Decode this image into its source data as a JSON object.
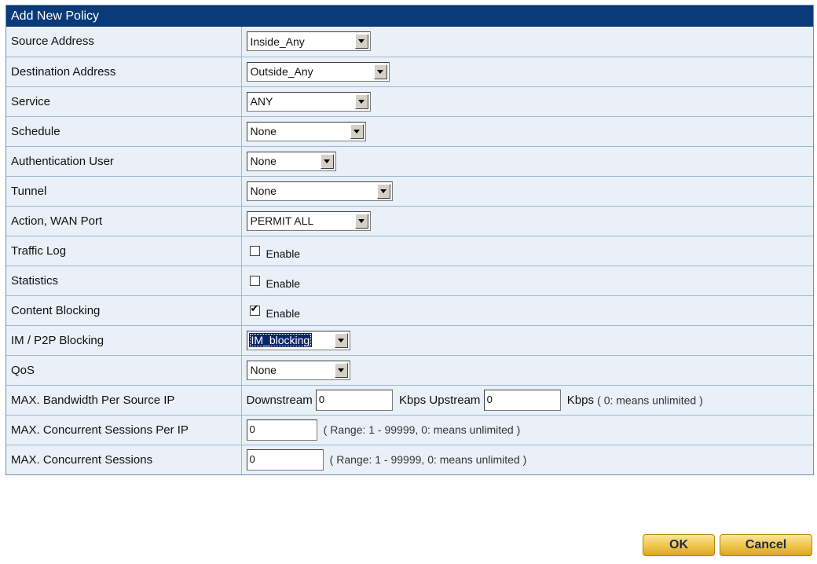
{
  "panel": {
    "title": "Add New Policy"
  },
  "rows": {
    "source_address": {
      "label": "Source Address",
      "value": "Inside_Any"
    },
    "destination_address": {
      "label": "Destination Address",
      "value": "Outside_Any"
    },
    "service": {
      "label": "Service",
      "value": "ANY"
    },
    "schedule": {
      "label": "Schedule",
      "value": "None"
    },
    "auth_user": {
      "label": "Authentication User",
      "value": "None"
    },
    "tunnel": {
      "label": "Tunnel",
      "value": "None"
    },
    "action_wan": {
      "label": "Action, WAN Port",
      "value": "PERMIT ALL"
    },
    "traffic_log": {
      "label": "Traffic Log",
      "checkbox_label": "Enable",
      "checked": false
    },
    "statistics": {
      "label": "Statistics",
      "checkbox_label": "Enable",
      "checked": false
    },
    "content_blocking": {
      "label": "Content Blocking",
      "checkbox_label": "Enable",
      "checked": true
    },
    "im_p2p": {
      "label": "IM / P2P Blocking",
      "value": "IM_blocking"
    },
    "qos": {
      "label": "QoS",
      "value": "None"
    },
    "max_bw": {
      "label": "MAX. Bandwidth Per Source IP",
      "downstream_label": "Downstream",
      "downstream_value": "0",
      "kbps_upstream_label": "Kbps Upstream",
      "upstream_value": "0",
      "kbps_label": "Kbps",
      "note": "( 0: means unlimited )"
    },
    "max_sessions_ip": {
      "label": "MAX. Concurrent Sessions Per IP",
      "value": "0",
      "note": "( Range: 1 - 99999, 0: means unlimited )"
    },
    "max_sessions": {
      "label": "MAX. Concurrent Sessions",
      "value": "0",
      "note": "( Range: 1 - 99999, 0: means unlimited )"
    }
  },
  "buttons": {
    "ok": "OK",
    "cancel": "Cancel"
  },
  "colors": {
    "header_bg": "#0a3a78",
    "panel_bg": "#e9f0f8",
    "button_gold": "#f0c44a"
  }
}
